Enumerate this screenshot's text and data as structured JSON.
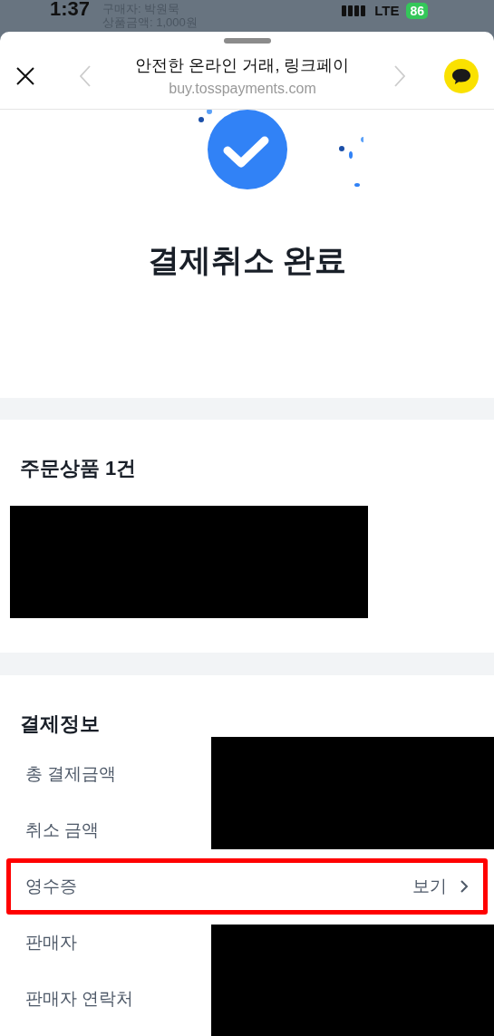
{
  "status_bar": {
    "time": "1:37",
    "network": "LTE",
    "battery": "86"
  },
  "background_page": {
    "lines": [
      "구매자: 박원묵",
      "상품금액: 1,000원"
    ]
  },
  "header": {
    "title": "안전한 온라인 거래, 링크페이",
    "url": "buy.tosspayments.com"
  },
  "result": {
    "title": "결제취소 완료"
  },
  "order": {
    "title": "주문상품 1건"
  },
  "payment_info": {
    "title": "결제정보",
    "rows": [
      {
        "label": "총 결제금액",
        "highlighted": false
      },
      {
        "label": "취소 금액",
        "highlighted": false
      },
      {
        "label": "영수증",
        "action": "보기",
        "highlighted": true
      },
      {
        "label": "판매자",
        "highlighted": false
      },
      {
        "label": "판매자 연락처",
        "highlighted": false
      }
    ]
  }
}
